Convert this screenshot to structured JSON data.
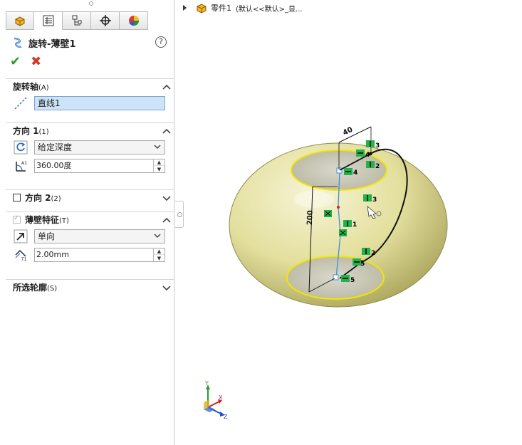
{
  "feature_tree": {
    "part_label": "零件1",
    "config_label": "(默认<<默认>_显..."
  },
  "panel": {
    "tabs": [
      "feature-manager",
      "property-manager",
      "configuration-manager",
      "dimxpert-manager",
      "display-manager"
    ],
    "feature_title": "旋转-薄壁1",
    "help": "?",
    "ok": "✔",
    "cancel": "✖",
    "axis_section": {
      "title": "旋转轴",
      "suffix": "(A)",
      "value": "直线1"
    },
    "direction1_section": {
      "title": "方向 1",
      "suffix": "(1)",
      "end_condition": "给定深度",
      "angle": "360.00度"
    },
    "direction2_section": {
      "title": "方向 2",
      "suffix": "(2)"
    },
    "thin_section": {
      "title": "薄壁特征",
      "suffix": "(T)",
      "type": "单向",
      "thickness": "2.00mm"
    },
    "contours_section": {
      "title": "所选轮廓",
      "suffix": "(S)"
    }
  },
  "sketch": {
    "top_dim": "40",
    "height_dim": "200",
    "relation_numbers": [
      "3",
      "4",
      "2",
      "4",
      "3",
      "1",
      "2",
      "5",
      "5"
    ]
  },
  "triad": {
    "x": "X",
    "y": "Y",
    "z": "Z"
  },
  "colors": {
    "body_fill": "#e8e5ad",
    "highlight_yellow": "#f2e600",
    "sketch_blue": "#3f8fd8",
    "relation_green": "#22b14c",
    "ok_green": "#2f9b2f",
    "cancel_red": "#d03a2a"
  }
}
